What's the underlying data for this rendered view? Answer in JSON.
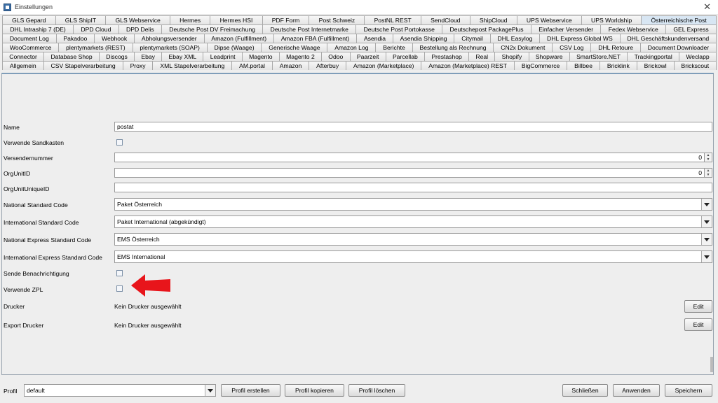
{
  "window": {
    "title": "Einstellungen",
    "close": "✕"
  },
  "tabs": {
    "rows": [
      [
        "GLS Gepard",
        "GLS ShipIT",
        "GLS Webservice",
        "Hermes",
        "Hermes HSI",
        "PDF Form",
        "Post Schweiz",
        "PostNL REST",
        "SendCloud",
        "ShipCloud",
        "UPS Webservice",
        "UPS Worldship",
        "Österreichische Post"
      ],
      [
        "DHL Intraship 7 (DE)",
        "DPD Cloud",
        "DPD Delis",
        "Deutsche Post DV Freimachung",
        "Deutsche Post Internetmarke",
        "Deutsche Post Portokasse",
        "Deutschepost PackagePlus",
        "Einfacher Versender",
        "Fedex Webservice",
        "GEL Express"
      ],
      [
        "Document Log",
        "Pakadoo",
        "Webhook",
        "Abholungsversender",
        "Amazon (Fulfillment)",
        "Amazon FBA (Fulfillment)",
        "Asendia",
        "Asendia Shipping",
        "Citymail",
        "DHL Easylog",
        "DHL Express Global WS",
        "DHL Geschäftskundenversand"
      ],
      [
        "WooCommerce",
        "plentymarkets (REST)",
        "plentymarkets (SOAP)",
        "Dipse (Waage)",
        "Generische Waage",
        "Amazon Log",
        "Berichte",
        "Bestellung als Rechnung",
        "CN2x Dokument",
        "CSV Log",
        "DHL Retoure",
        "Document Downloader"
      ],
      [
        "Connector",
        "Database Shop",
        "Discogs",
        "Ebay",
        "Ebay XML",
        "Leadprint",
        "Magento",
        "Magento 2",
        "Odoo",
        "Paarzeit",
        "Parcellab",
        "Prestashop",
        "Real",
        "Shopify",
        "Shopware",
        "SmartStore.NET",
        "Trackingportal",
        "Weclapp"
      ],
      [
        "Allgemein",
        "CSV Stapelverarbeitung",
        "Proxy",
        "XML Stapelverarbeitung",
        "AM.portal",
        "Amazon",
        "Afterbuy",
        "Amazon (Marketplace)",
        "Amazon (Marketplace) REST",
        "BigCommerce",
        "Billbee",
        "Bricklink",
        "Brickowl",
        "Brickscout"
      ]
    ],
    "active": "Österreichische Post"
  },
  "form": {
    "name_label": "Name",
    "name_value": "postat",
    "sandbox_label": "Verwende Sandkasten",
    "sender_label": "Versendernummer",
    "sender_value": "0",
    "orgunit_label": "OrgUnitID",
    "orgunit_value": "0",
    "orgunit_unique_label": "OrgUnitUniqueID",
    "orgunit_unique_value": "",
    "nat_std_label": "National Standard Code",
    "nat_std_value": "Paket Österreich",
    "int_std_label": "International Standard Code",
    "int_std_value": "Paket International (abgekündigt)",
    "nat_exp_label": "National Express Standard Code",
    "nat_exp_value": "EMS Österreich",
    "int_exp_label": "International Express Standard Code",
    "int_exp_value": "EMS International",
    "notify_label": "Sende Benachrichtigung",
    "zpl_label": "Verwende ZPL",
    "printer_label": "Drucker",
    "printer_value": "Kein Drucker ausgewählt",
    "export_printer_label": "Export Drucker",
    "export_printer_value": "Kein Drucker ausgewählt",
    "edit_label": "Edit"
  },
  "bottom": {
    "profile_label": "Profil",
    "profile_value": "default",
    "create_label": "Profil erstellen",
    "copy_label": "Profil kopieren",
    "delete_label": "Profil löschen",
    "close_label": "Schließen",
    "apply_label": "Anwenden",
    "save_label": "Speichern"
  },
  "colors": {
    "annotation_arrow": "#e8151b",
    "active_tab": "#d8e6f3"
  }
}
